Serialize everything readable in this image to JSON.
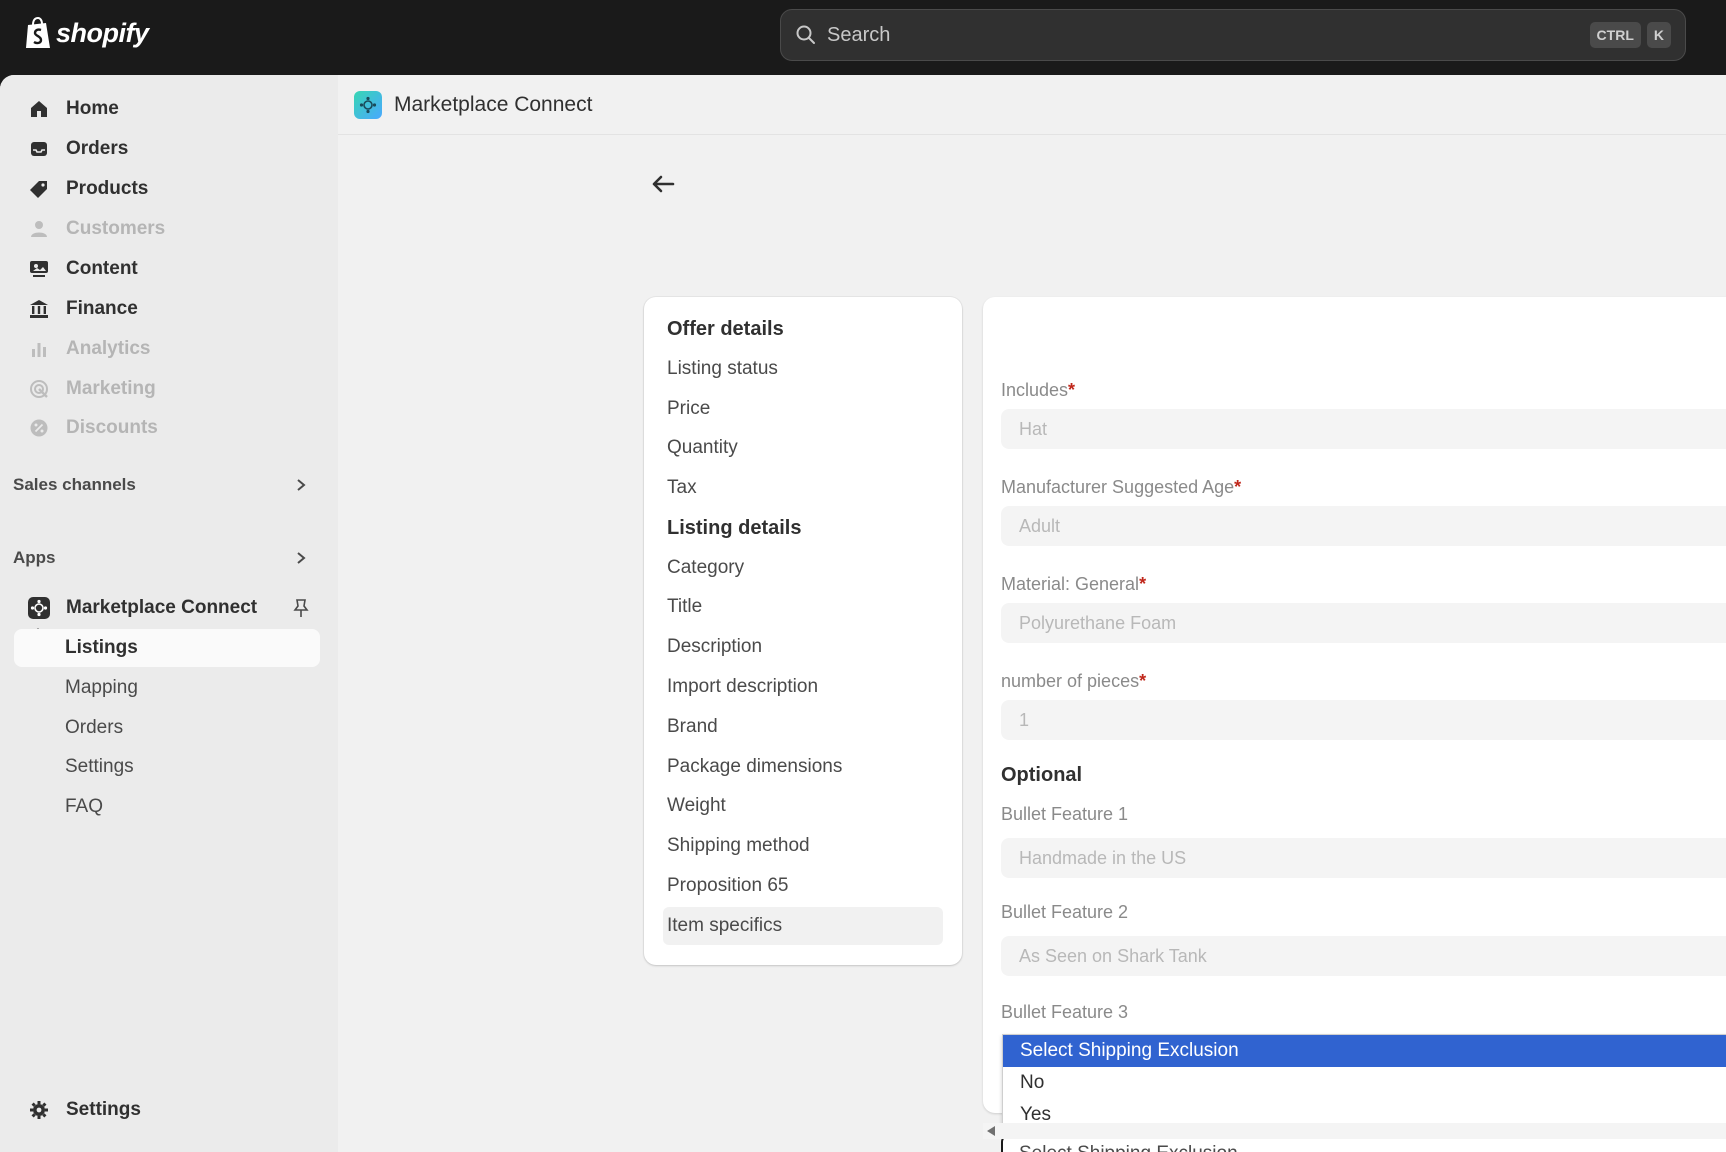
{
  "brand": {
    "name": "shopify"
  },
  "search": {
    "placeholder": "Search",
    "shortcut": [
      "CTRL",
      "K"
    ]
  },
  "sidebar": {
    "main_items": [
      {
        "label": "Home",
        "icon": "home-icon",
        "disabled": false
      },
      {
        "label": "Orders",
        "icon": "inbox-icon",
        "disabled": false
      },
      {
        "label": "Products",
        "icon": "tag-icon",
        "disabled": false
      },
      {
        "label": "Customers",
        "icon": "person-icon",
        "disabled": true
      },
      {
        "label": "Content",
        "icon": "content-icon",
        "disabled": false
      },
      {
        "label": "Finance",
        "icon": "bank-icon",
        "disabled": false
      },
      {
        "label": "Analytics",
        "icon": "bar-chart-icon",
        "disabled": true
      },
      {
        "label": "Marketing",
        "icon": "target-icon",
        "disabled": true
      },
      {
        "label": "Discounts",
        "icon": "discount-icon",
        "disabled": true
      }
    ],
    "sales_channels": "Sales channels",
    "apps": "Apps",
    "app_name": "Marketplace Connect",
    "app_sub_items": [
      "Listings",
      "Mapping",
      "Orders",
      "Settings",
      "FAQ"
    ],
    "settings": "Settings"
  },
  "app_header": {
    "title": "Marketplace Connect"
  },
  "section_nav": {
    "items": [
      {
        "label": "Offer details",
        "heading": true
      },
      {
        "label": "Listing status"
      },
      {
        "label": "Price"
      },
      {
        "label": "Quantity"
      },
      {
        "label": "Tax"
      },
      {
        "label": "Listing details",
        "heading": true
      },
      {
        "label": "Category"
      },
      {
        "label": "Title"
      },
      {
        "label": "Description"
      },
      {
        "label": "Import description"
      },
      {
        "label": "Brand"
      },
      {
        "label": "Package dimensions"
      },
      {
        "label": "Weight"
      },
      {
        "label": "Shipping method"
      },
      {
        "label": "Proposition 65"
      },
      {
        "label": "Item specifics",
        "active": true
      }
    ]
  },
  "form": {
    "fields": [
      {
        "label": "Includes",
        "required": true,
        "value": "Hat"
      },
      {
        "label": "Manufacturer Suggested Age",
        "required": true,
        "value": "Adult"
      },
      {
        "label": "Material: General",
        "required": true,
        "value": "Polyurethane Foam"
      },
      {
        "label": "number of pieces",
        "required": true,
        "value": "1"
      }
    ],
    "optional_heading": "Optional",
    "optional_fields": [
      {
        "label": "Bullet Feature 1",
        "value": "Handmade in the US"
      },
      {
        "label": "Bullet Feature 2",
        "value": "As Seen on Shark Tank"
      }
    ],
    "bullet3_label": "Bullet Feature 3",
    "dropdown_options": [
      "Select Shipping Exclusion",
      "No",
      "Yes"
    ],
    "select_value": "Select Shipping Exclusion"
  }
}
